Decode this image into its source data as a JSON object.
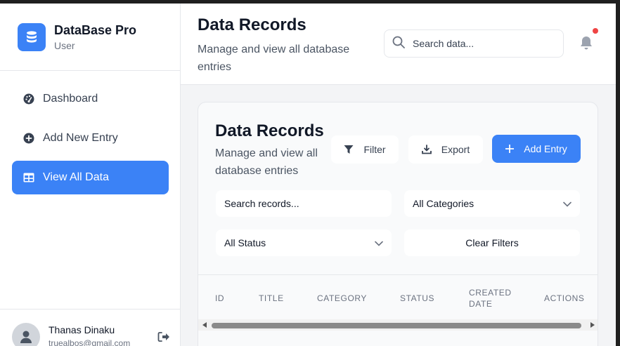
{
  "brand": {
    "title": "DataBase Pro",
    "subtitle": "User",
    "icon": "database-icon"
  },
  "sidebar": {
    "items": [
      {
        "label": "Dashboard",
        "icon": "dashboard-icon",
        "active": false
      },
      {
        "label": "Add New Entry",
        "icon": "plus-circle-icon",
        "active": false
      },
      {
        "label": "View All Data",
        "icon": "table-icon",
        "active": true
      }
    ]
  },
  "user": {
    "name": "Thanas Dinaku",
    "email": "truealbos@gmail.com",
    "avatar_icon": "user-icon",
    "logout_icon": "logout-icon"
  },
  "header": {
    "title": "Data Records",
    "subtitle": "Manage and view all database entries",
    "search_placeholder": "Search data...",
    "notification_icon": "bell-icon"
  },
  "card": {
    "title": "Data Records",
    "subtitle": "Manage and view all database entries",
    "buttons": {
      "filter": "Filter",
      "export": "Export",
      "add": "Add Entry"
    },
    "filters": {
      "search_placeholder": "Search records...",
      "category_value": "All Categories",
      "status_value": "All Status",
      "clear": "Clear Filters"
    },
    "columns": [
      "ID",
      "TITLE",
      "CATEGORY",
      "STATUS",
      "CREATED DATE",
      "ACTIONS"
    ]
  },
  "colors": {
    "accent": "#3b82f6",
    "badge": "#ef4444",
    "background": "#f3f4f6"
  }
}
